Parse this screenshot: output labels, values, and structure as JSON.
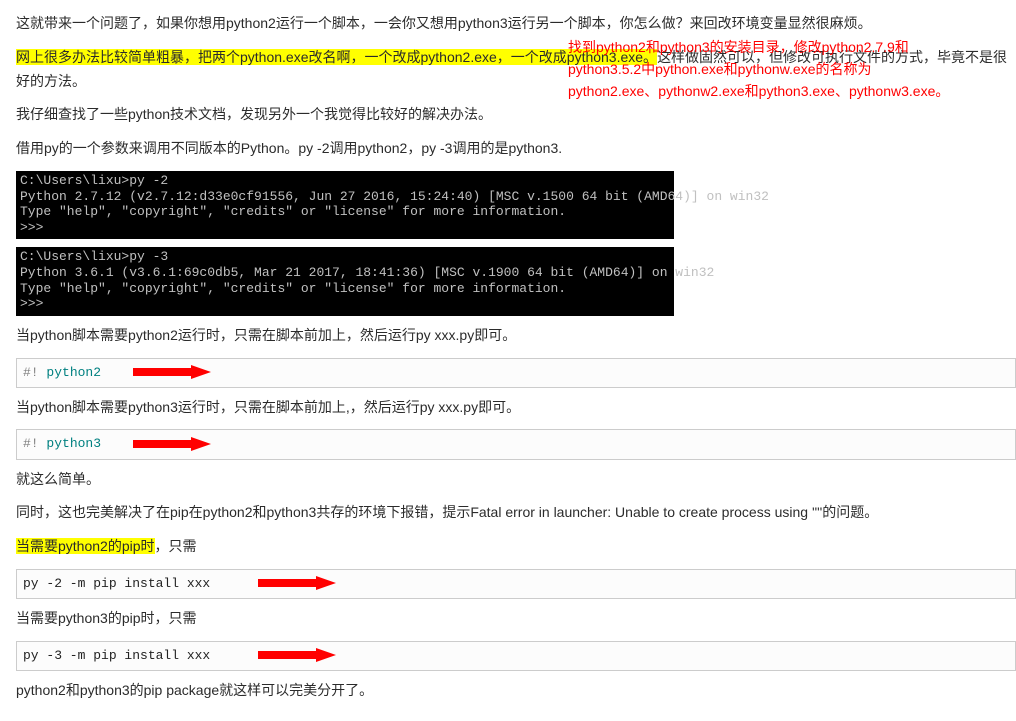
{
  "para": {
    "l1": "这就带来一个问题了，如果你想用python2运行一个脚本，一会你又想用python3运行另一个脚本，你怎么做？来回改环境变量显然很麻烦。",
    "l2_hl": "网上很多办法比较简单粗暴，把两个python.exe改名啊，一个改成python2.exe，一个改成python3.exe。",
    "l2_rest": "这样做固然可以，但修改可执行文件的方式，毕竟不是很好的方法。",
    "l3": "我仔细查找了一些python技术文档，发现另外一个我觉得比较好的解决办法。",
    "l4": "借用py的一个参数来调用不同版本的Python。py -2调用python2，py -3调用的是python3.",
    "mid1": "当python脚本需要python2运行时，只需在脚本前加上，然后运行py xxx.py即可。",
    "mid2": "当python脚本需要python3运行时，只需在脚本前加上,，然后运行py xxx.py即可。",
    "simple": "就这么简单。",
    "pipfix": "同时，这也完美解决了在pip在python2和python3共存的环境下报错，提示Fatal error in launcher: Unable to create process using '\"'的问题。",
    "pip2_hl": "当需要python2的pip时",
    "pip2_rest": "，只需",
    "pip3": "当需要python3的pip时，只需",
    "end": "python2和python3的pip package就这样可以完美分开了。"
  },
  "annot": {
    "a1": "找到python2和python3的安装目录，修改python2.7.9和",
    "a2": "python3.5.2中python.exe和pythonw.exe的名称为",
    "a3": "python2.exe、pythonw2.exe和python3.exe、pythonw3.exe。"
  },
  "term1": {
    "l1": "C:\\Users\\lixu>py -2",
    "l2": "Python 2.7.12 (v2.7.12:d33e0cf91556, Jun 27 2016, 15:24:40) [MSC v.1500 64 bit (AMD64)] on win32",
    "l3": "Type \"help\", \"copyright\", \"credits\" or \"license\" for more information.",
    "l4": ">>>"
  },
  "term2": {
    "l1": "C:\\Users\\lixu>py -3",
    "l2": "Python 3.6.1 (v3.6.1:69c0db5, Mar 21 2017, 18:41:36) [MSC v.1900 64 bit (AMD64)] on win32",
    "l3": "Type \"help\", \"copyright\", \"credits\" or \"license\" for more information.",
    "l4": ">>>"
  },
  "code": {
    "shebang2_a": "#!",
    "shebang2_b": " python2",
    "shebang3_a": "#!",
    "shebang3_b": " python3",
    "pip2": "py -2 -m pip install xxx",
    "pip3": "py -3 -m pip install xxx"
  }
}
